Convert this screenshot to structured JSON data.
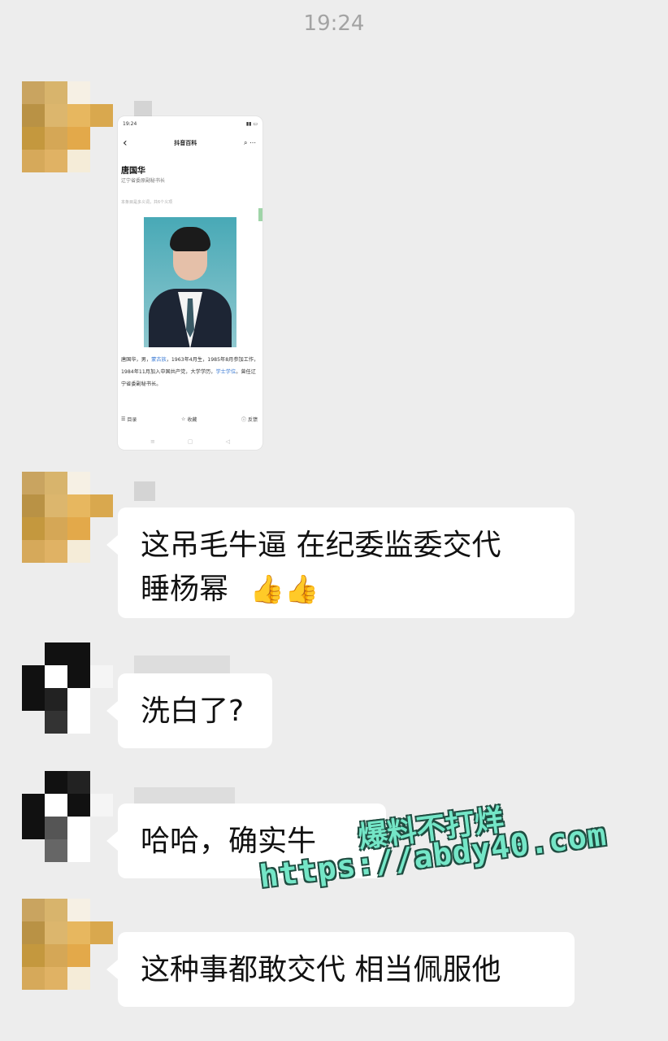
{
  "chat": {
    "timestamp": "19:24",
    "messages": [
      {
        "type": "image"
      },
      {
        "type": "text",
        "line1": "这吊毛牛逼   在纪委监委交代",
        "line2": "睡杨幂",
        "emoji": "👍👍"
      },
      {
        "type": "text",
        "text": "洗白了?"
      },
      {
        "type": "text",
        "text": "哈哈，确实牛"
      },
      {
        "type": "text",
        "text": "这种事都敢交代   相当佩服他"
      }
    ]
  },
  "screenshot_card": {
    "status_left": "19:24",
    "app_title": "抖音百科",
    "person_name": "唐国华",
    "person_role": "辽宁省委原副秘书长",
    "hint": "本条目是多义词，共6个义项",
    "bio_part1": "唐国华，男，",
    "bio_link1": "蒙古族",
    "bio_part2": "，1963年4月生，1985年8月参加工作，1984年11月加入中国共产党，大学学历，",
    "bio_link2": "学士学位",
    "bio_part3": "。曾任辽宁省委副秘书长。",
    "toolbar_contents": "目录",
    "toolbar_collect": "收藏",
    "toolbar_feedback": "反馈"
  },
  "watermark": {
    "line1": "爆料不打烊",
    "line2": "https://abdy40.com"
  },
  "colors": {
    "background": "#ededed",
    "bubble": "#ffffff",
    "watermark": "#74e6c7"
  }
}
